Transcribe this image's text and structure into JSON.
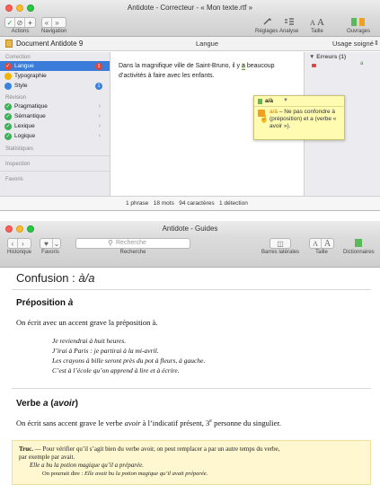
{
  "window1": {
    "title": "Antidote - Correcteur - « Mon texte.rtf »",
    "toolbar": {
      "actions_label": "Actions",
      "navigation_label": "Navigation",
      "reglages_label": "Réglages",
      "analyse_label": "Analyse",
      "taille_label": "Taille",
      "ouvrages_label": "Ouvrages",
      "font_small": "A",
      "font_large": "A",
      "check_glyph": "✓",
      "cancel_glyph": "⊘",
      "plus_glyph": "+",
      "back_glyph": "«",
      "forward_glyph": "»"
    },
    "header": {
      "doc_title": "Document Antidote 9",
      "column": "Langue",
      "usage": "Usage soigné"
    },
    "sidebar": {
      "sections": {
        "correction": "Correction",
        "revision": "Révision",
        "statistiques": "Statistiques",
        "inspection": "Inspection",
        "favoris": "Favoris"
      },
      "items": [
        {
          "label": "Langue",
          "badge": "1",
          "color": "#e0463b"
        },
        {
          "label": "Typographie",
          "badge": "",
          "color": "#f0b400"
        },
        {
          "label": "Style",
          "badge": "1",
          "color": "#3a82e0"
        },
        {
          "label": "Pragmatique",
          "color": "#3cb058"
        },
        {
          "label": "Sémantique",
          "color": "#3cb058"
        },
        {
          "label": "Lexique",
          "color": "#3cb058"
        },
        {
          "label": "Logique",
          "color": "#3cb058"
        }
      ]
    },
    "editor": {
      "line1_before": "Dans la magnifique ville de Saint-Bruno, il y ",
      "line1_error": "a",
      "line1_after": " beaucoup",
      "line2": "d’activités à faire avec les enfants."
    },
    "errors": {
      "header": "▼ Erreurs (1)",
      "item": "a"
    },
    "popup": {
      "suggestion": "a/à",
      "caret": "▼",
      "message_prefix": "a/à",
      "message": " – Ne pas confondre à (préposition) et a (verbe « avoir »)."
    },
    "status": "1 phrase   18 mots   94 caractères   1 détection"
  },
  "window2": {
    "title": "Antidote - Guides",
    "toolbar": {
      "historique_label": "Historique",
      "favoris_label": "Favoris",
      "search_placeholder": "Recherche",
      "recherche_label": "Recherche",
      "barres_label": "Barres latérales",
      "taille_label": "Taille",
      "dictionnaires_label": "Dictionnaires",
      "font_small": "A",
      "font_large": "A",
      "back_glyph": "‹",
      "forward_glyph": "›",
      "heart_glyph": "♥"
    },
    "title_prefix": "Confusion : ",
    "title_italic": "à/a",
    "section1": {
      "heading_plain": "Préposition ",
      "heading_italic": "à",
      "intro": "On écrit avec un accent grave la préposition à.",
      "examples": [
        "Je reviendrai à huit heures.",
        "J’irai à Paris : je partirai à la mi-avril.",
        "Les crayons à bille seront près du pot à fleurs, à gauche.",
        "C’est à l’école qu’on apprend à lire et à écrire."
      ]
    },
    "section2": {
      "heading_plain": "Verbe ",
      "heading_italic": "a",
      "heading_paren_open": " (",
      "heading_paren_word": "avoir",
      "heading_paren_close": ")",
      "intro_before": "On écrit sans accent grave le verbe ",
      "intro_word": "avoir",
      "intro_after": " à l’indicatif présent, 3",
      "intro_sup": "e",
      "intro_end": " personne du singulier."
    },
    "truc": {
      "label": "Truc.",
      "text1": " — Pour vérifier qu’il s’agit bien du verbe avoir, on peut remplacer a par un autre temps du verbe,",
      "text2": "par exemple par avait.",
      "example1": "Elle a bu la potion magique qu’il a préparée.",
      "example2_prefix": "On pourrait dire : ",
      "example2": "Elle avait bu la potion magique qu’il avait préparée."
    }
  }
}
